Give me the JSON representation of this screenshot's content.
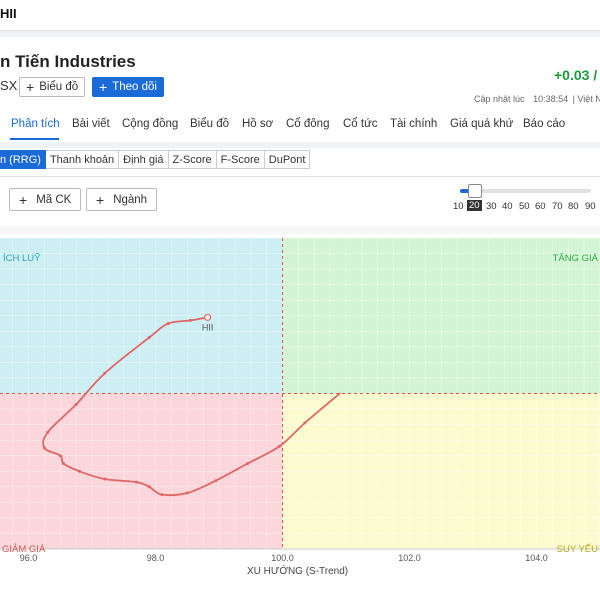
{
  "topbar": {
    "ticker": "HII"
  },
  "header": {
    "company": "n Tiến Industries",
    "exchange": "SX",
    "chart_button": "Biểu đồ",
    "follow_button": "Theo dõi",
    "price_change": "+0.03 /",
    "updated_label": "Cập nhật lúc",
    "updated_time": "10:38:54",
    "updated_suffix": "| Việt Na"
  },
  "tabs": [
    "Phân tích",
    "Bài viết",
    "Cộng đồng",
    "Biểu đồ",
    "Hồ sơ",
    "Cổ đông",
    "Cổ tức",
    "Tài chính",
    "Giá quá khứ",
    "Báo cáo"
  ],
  "subtabs": [
    "n (RRG)",
    "Thanh khoản",
    "Định giá",
    "Z-Score",
    "F-Score",
    "DuPont"
  ],
  "controls": {
    "symbol_button": "Mã CK",
    "sector_button": "Ngành",
    "slider_marks": [
      "10",
      "20",
      "30",
      "40",
      "50",
      "60",
      "70",
      "80",
      "90"
    ],
    "slider_selected": "20",
    "slider_value": 20
  },
  "colors": {
    "accent": "#1a6ad8",
    "positive": "#1a9c3a",
    "series": "#e06666"
  },
  "chart_data": {
    "type": "scatter",
    "xlabel": "XU HƯỚNG (S-Trend)",
    "ylabel": "",
    "xlim": [
      95.55,
      105.0
    ],
    "ylim": [
      -1,
      1
    ],
    "x_ticks": [
      "96.0",
      "98.0",
      "100.0",
      "102.0",
      "104.0"
    ],
    "x_tick_values": [
      96,
      98,
      100,
      102,
      104
    ],
    "center_x": 100,
    "center_y": 0,
    "grid": true,
    "quadrants": {
      "top_left": "ÍCH LUỸ",
      "top_right": "TĂNG GIÁ",
      "bottom_left": "GIẢM GIÁ",
      "bottom_right": "SUY YẾU"
    },
    "series": [
      {
        "name": "HII",
        "points": [
          [
            100.9,
            0.0
          ],
          [
            100.35,
            -0.19
          ],
          [
            99.95,
            -0.34
          ],
          [
            99.45,
            -0.45
          ],
          [
            98.95,
            -0.56
          ],
          [
            98.5,
            -0.64
          ],
          [
            98.1,
            -0.65
          ],
          [
            97.9,
            -0.6
          ],
          [
            97.7,
            -0.57
          ],
          [
            97.2,
            -0.55
          ],
          [
            96.8,
            -0.5
          ],
          [
            96.55,
            -0.45
          ],
          [
            96.5,
            -0.4
          ],
          [
            96.25,
            -0.35
          ],
          [
            96.3,
            -0.25
          ],
          [
            96.75,
            -0.07
          ],
          [
            97.2,
            0.13
          ],
          [
            97.9,
            0.36
          ],
          [
            98.2,
            0.45
          ],
          [
            98.55,
            0.47
          ],
          [
            98.82,
            0.49
          ]
        ]
      }
    ]
  }
}
